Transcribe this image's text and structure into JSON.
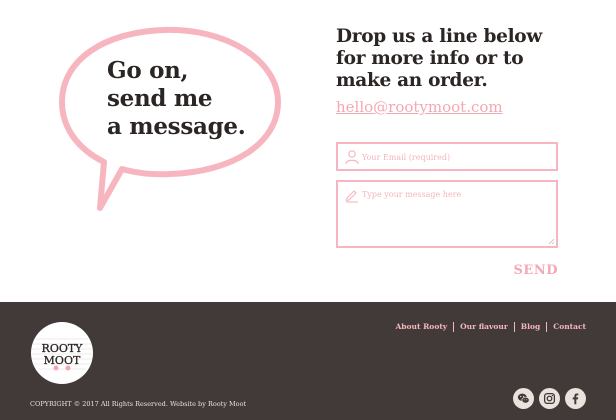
{
  "bubble": {
    "text": "Go on,\nsend me\na message."
  },
  "contact": {
    "headline": "Drop us a line below\nfor more info or to\nmake an order.",
    "email": "hello@rootymoot.com"
  },
  "form": {
    "email_placeholder": "Your Email (required)",
    "message_placeholder": "Type your message here",
    "send_label": "SEND"
  },
  "footer": {
    "logo_text_top": "ROOTY",
    "logo_text_bottom": "MOOT",
    "nav": [
      {
        "label": "About Rooty"
      },
      {
        "label": "Our flavour"
      },
      {
        "label": "Blog"
      },
      {
        "label": "Contact"
      }
    ],
    "copyright": "COPYRIGHT © 2017 All Rights Reserved. Website by Rooty Moot",
    "social_icons": [
      "wechat-icon",
      "instagram-icon",
      "facebook-icon"
    ]
  },
  "colors": {
    "accent_pink": "#f4a8b2",
    "footer_bg": "#413a38",
    "text_dark": "#2b2523"
  }
}
